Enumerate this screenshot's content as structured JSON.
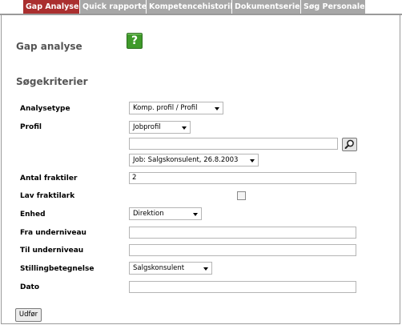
{
  "tabs": [
    {
      "label": "Gap Analyse",
      "active": true
    },
    {
      "label": "Quick rapporter",
      "active": false
    },
    {
      "label": "Kompetencehistorik",
      "active": false
    },
    {
      "label": "Dokumentserier",
      "active": false
    },
    {
      "label": "Søg Personale",
      "active": false
    }
  ],
  "page": {
    "title": "Gap analyse",
    "help_glyph": "?",
    "section_title": "Søgekriterier"
  },
  "form": {
    "analysetype": {
      "label": "Analysetype",
      "value": "Komp. profil / Profil"
    },
    "profil": {
      "label": "Profil",
      "type_value": "Jobprofil",
      "search_value": "",
      "job_value": "Job: Salgskonsulent, 26.8.2003"
    },
    "antal_fraktiler": {
      "label": "Antal fraktiler",
      "value": "2"
    },
    "lav_fraktilark": {
      "label": "Lav fraktilark",
      "checked": false
    },
    "enhed": {
      "label": "Enhed",
      "value": "Direktion"
    },
    "fra_underniveau": {
      "label": "Fra underniveau",
      "value": ""
    },
    "til_underniveau": {
      "label": "Til underniveau",
      "value": ""
    },
    "stillingbetegnelse": {
      "label": "Stillingbetegnelse",
      "value": "Salgskonsulent"
    },
    "dato": {
      "label": "Dato",
      "value": ""
    }
  },
  "actions": {
    "submit_label": "Udfør"
  },
  "colors": {
    "active_tab": "#aa2f2f",
    "inactive_tab": "#a7a7a7",
    "help_button": "#3f9a2a"
  }
}
